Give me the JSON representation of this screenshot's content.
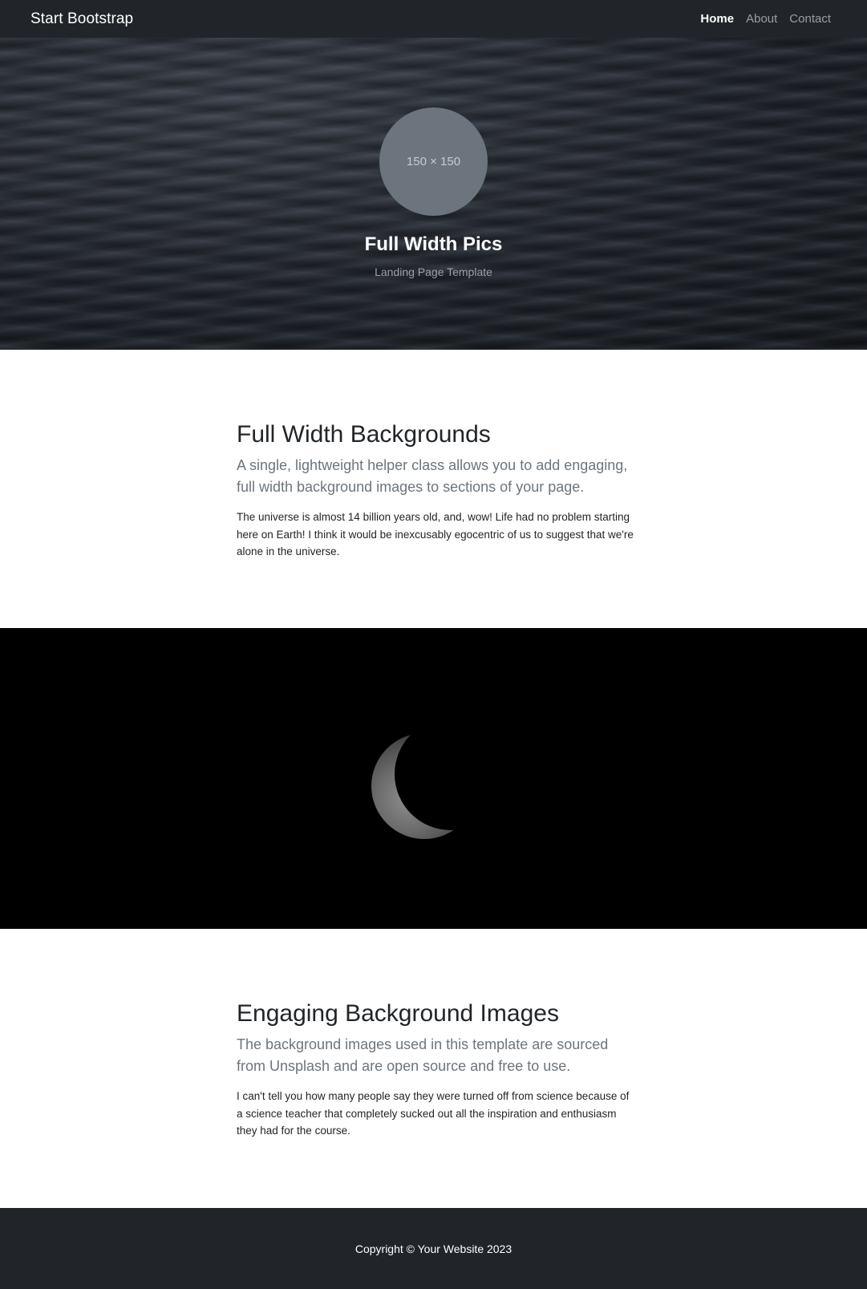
{
  "navbar": {
    "brand": "Start Bootstrap",
    "links": [
      {
        "label": "Home",
        "active": true
      },
      {
        "label": "About",
        "active": false
      },
      {
        "label": "Contact",
        "active": false
      }
    ]
  },
  "hero": {
    "avatar_placeholder": "150 × 150",
    "title": "Full Width Pics",
    "subtitle": "Landing Page Template"
  },
  "section1": {
    "heading": "Full Width Backgrounds",
    "lead": "A single, lightweight helper class allows you to add engaging, full width background images to sections of your page.",
    "body": "The universe is almost 14 billion years old, and, wow! Life had no problem starting here on Earth! I think it would be inexcusably egocentric of us to suggest that we're alone in the universe."
  },
  "section2": {
    "heading": "Engaging Background Images",
    "lead": "The background images used in this template are sourced from Unsplash and are open source and free to use.",
    "body": "I can't tell you how many people say they were turned off from science because of a science teacher that completely sucked out all the inspiration and enthusiasm they had for the course."
  },
  "footer": {
    "copyright": "Copyright © Your Website 2023"
  },
  "colors": {
    "navbar_bg": "#212529",
    "avatar_bg": "#6c757d",
    "lead_text": "#6c757d"
  }
}
